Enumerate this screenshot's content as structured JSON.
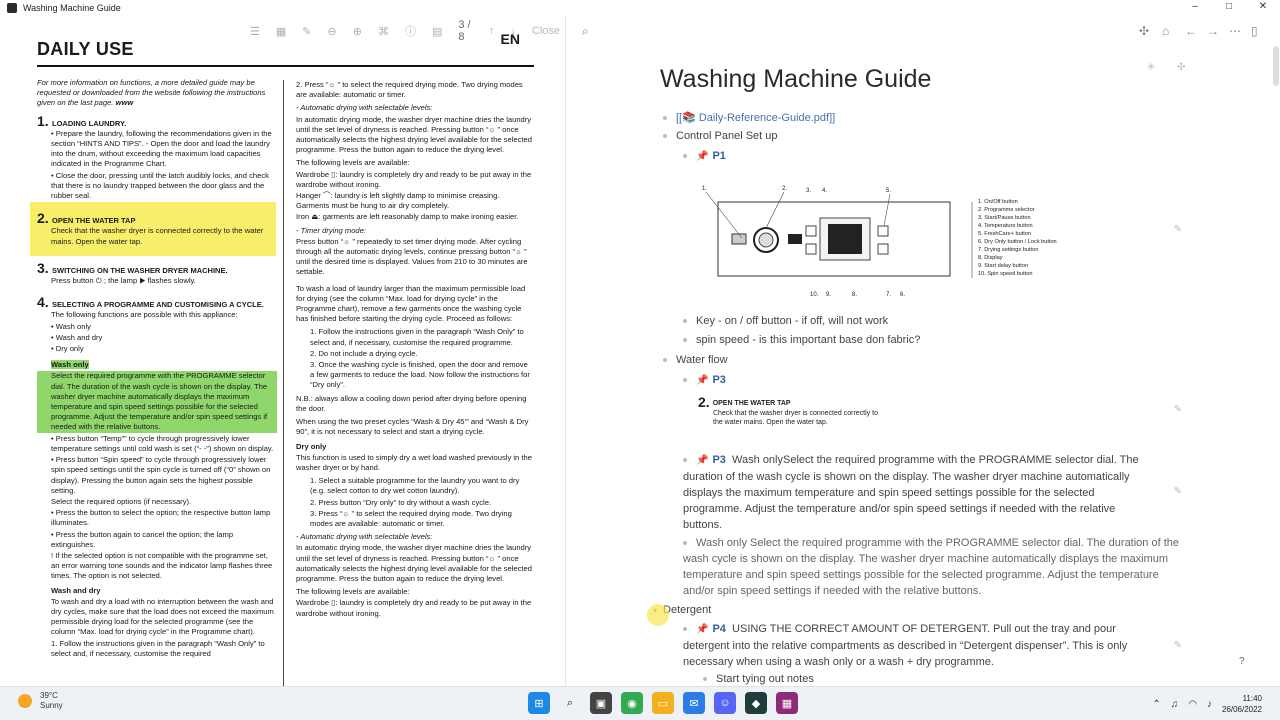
{
  "window": {
    "title": "Washing Machine Guide",
    "controls": [
      "–",
      "□",
      "✕"
    ]
  },
  "pdf_toolbar": {
    "pager": "3 / 8",
    "close": "Close"
  },
  "pdf": {
    "heading": "DAILY USE",
    "lang": "EN",
    "intro": "For more information on functions, a more detailed guide may be requested or downloaded from the website following the instructions given on the last page.",
    "intro_www": "www",
    "s1_num": "1.",
    "s1_head": "LOADING LAUNDRY.",
    "s1_b1": "• Prepare the laundry, following the recommendations given in the section “HINTS AND TIPS”. - Open the door and load the laundry into the drum, without exceeding the maximum load capacities indicated in the Programme Chart.",
    "s1_b2": "• Close the door, pressing until the latch audibly locks, and check that there is no laundry trapped between the door glass and the rubber seal.",
    "s2_num": "2.",
    "s2_head": "OPEN THE WATER TAP",
    "s2_body": "Check that the washer dryer is connected correctly to the water mains. Open the water tap.",
    "s3_num": "3.",
    "s3_head": "SWITCHING ON THE WASHER DRYER MACHINE.",
    "s3_body": "Press button ⏻ ; the lamp ▶ flashes slowly.",
    "s4_num": "4.",
    "s4_head": "SELECTING A PROGRAMME AND CUSTOMISING A CYCLE.",
    "s4_body": "The following functions are possible with this appliance:",
    "s4_list": [
      "• Wash only",
      "• Wash and dry",
      "• Dry only"
    ],
    "wash_only_head": "Wash only",
    "wash_only_body": "Select the required programme with the PROGRAMME selector dial. The duration of the wash cycle is shown on the display. The washer dryer machine automatically displays the maximum temperature and spin speed settings possible for the selected programme. Adjust the temperature and/or spin speed settings if needed with the relative buttons.",
    "temp_bullet": "• Press button “Temp”” to cycle through progressively lower temperature settings until cold wash is set (“- -”) shown on display.",
    "spin_bullet": "• Press button “Spin speed” to cycle through progressively lower spin speed settings until the spin cycle is turned off (“0” shown on display). Pressing the button again sets the highest possible setting.",
    "select_opts": "Select the required options (if necessary).",
    "press_opt1": "• Press the button to select the option; the respective button lamp illuminates.",
    "press_opt2": "• Press the button again to cancel the option; the lamp extinguishes.",
    "not_compat": "! If the selected option is not compatible with the programme set, an error warning tone sounds and the indicator lamp flashes three times. The option is not selected.",
    "wash_dry_head": "Wash and dry",
    "wash_dry_body": "To wash and dry a load with no interruption between the wash and dry cycles, make sure that the load does not exceed the maximum permissible drying load for the selected programme (see the column “Max. load for drying cycle” in the Programme chart).",
    "wash_dry_1": "1. Follow the instructions given in the paragraph “Wash Only” to select and, if necessary, customise the required",
    "c2_p1": "2. Press “☼ ” to select the required drying mode. Two drying modes are available: automatic or timer.",
    "c2_auto_head": "- Automatic drying with selectable levels:",
    "c2_auto_body": "In automatic drying mode, the washer dryer machine dries the laundry until the set level of dryness is reached. Pressing button “☼ ” once automatically selects the highest drying level available for the selected programme. Press the button again to reduce the drying level.",
    "c2_levels": "The following levels are available:",
    "c2_wardrobe": "Wardrobe ▯: laundry is completely dry and ready to be put away in the wardrobe without ironing.",
    "c2_hanger": "Hanger ⌒: laundry is left slightly damp to minimise creasing. Garments must be hung to air dry completely.",
    "c2_iron": "Iron ⏏: garments are left reasonably damp to make ironing easier.",
    "c2_timer_head": "- Timer drying mode:",
    "c2_timer_body": "Press button “☼ ” repeatedly to set timer drying mode. After cycling through all the automatic drying levels, continue pressing button “☼ ” until the desired time is displayed. Values from 210 to 30 minutes are settable.",
    "c2_larger": "To wash a load of laundry larger than the maximum permissible load for drying (see the column “Max. load for drying cycle” in the Programme chart), remove a few garments once the washing cycle has finished before starting the drying cycle. Proceed as follows:",
    "c2_f1": "1. Follow the instructions given in the paragraph “Wash Only” to select and, if necessary, customise the required programme.",
    "c2_f2": "2. Do not include a drying cycle.",
    "c2_f3": "3. Once the washing cycle is finished, open the door and remove a few garments to reduce the load. Now follow the instructions for “Dry only”.",
    "c2_nb": "N.B.: always allow a cooling down period after drying before opening the door.",
    "c2_preset": "When using the two preset cycles “Wash & Dry 45’” and “Wash & Dry 90”, it is not necessary to select and start a drying cycle.",
    "c2_dry_head": "Dry only",
    "c2_dry_body": "This function is used to simply dry a wet load washed previously in the washer dryer or by hand.",
    "c2_d1": "1. Select a suitable programme for the laundry you want to dry (e.g. select cotton to dry wet cotton laundry).",
    "c2_d2": "2. Press button “Dry only” to dry without a wash cycle.",
    "c2_d3": "3. Press “☼ ” to select the required drying mode. Two drying modes are available: automatic or timer.",
    "c2_auto2_head": "- Automatic drying with selectable levels:",
    "c2_auto2_body": "In automatic drying mode, the washer dryer machine dries the laundry until the set level of dryness is reached. Pressing button “☼ ” once automatically selects the highest drying level available for the selected programme. Press the button again to reduce the drying level.",
    "c2_levels2": "The following levels are available:",
    "c2_wardrobe2": "Wardrobe ▯: laundry is completely dry and ready to be put away in the wardrobe without ironing."
  },
  "note": {
    "title": "Washing Machine Guide",
    "attachment": "[[📚 Daily-Reference-Guide.pdf]]",
    "control_panel": "Control Panel Set up",
    "p1": "P1",
    "diagram_labels": [
      "1. On/Off button",
      "2. Programme selector",
      "3. Start/Pause button",
      "4. Temperature button",
      "5. FreshCare+ button",
      "6. Dry Only button / Lock button",
      "7. Drying settings button",
      "8. Display",
      "9. Start delay button",
      "10. Spin speed button"
    ],
    "diagram_top_nums": [
      "1.",
      "2.",
      "3.",
      "4.",
      "5."
    ],
    "diagram_bottom_nums": [
      "10.",
      "9.",
      "8.",
      "7.",
      "6."
    ],
    "key_line": "Key - on / off button - if off, will not work",
    "spin_line": "spin speed - is this important base don fabric?",
    "water_flow": "Water flow",
    "p3": "P3",
    "openwater_num": "2.",
    "openwater_head": "OPEN THE WATER TAP",
    "openwater_body": "Check that the washer dryer is connected correctly to the water mains. Open the water tap.",
    "p3b_label": "P3",
    "p3b_text": "Wash onlySelect the required programme with the PROGRAMME selector dial. The duration of the wash cycle is shown on the display. The washer dryer machine automatically displays the maximum temperature and spin speed settings possible for the selected programme. Adjust the temperature and/or spin speed settings if needed with the relative buttons.",
    "wash_only_para": "Wash only Select the required programme with the PROGRAMME selector dial. The duration of the wash cycle is shown on the display. The washer dryer machine automatically displays the maximum temperature and spin speed settings possible for the selected programme. Adjust the temperature and/or spin speed settings if needed with the relative buttons.",
    "detergent": "Detergent",
    "p4_label": "P4",
    "p4_text": "USING THE CORRECT AMOUNT OF DETERGENT. Pull out the tray and pour detergent into the relative compartments as described in “Detergent dispenser”. This is only necessary when using a wash only or a wash + dry programme.",
    "start_notes": "Start tying out notes",
    "help": "?"
  },
  "taskbar": {
    "temp": "39°C",
    "weather": "Sunny",
    "time": "11:40",
    "date": "26/06/2022"
  },
  "colors": {
    "highlight_yellow": "#f7ee6a",
    "highlight_green": "#8fd66b",
    "link": "#4a70b0",
    "pin": "#d33333"
  }
}
